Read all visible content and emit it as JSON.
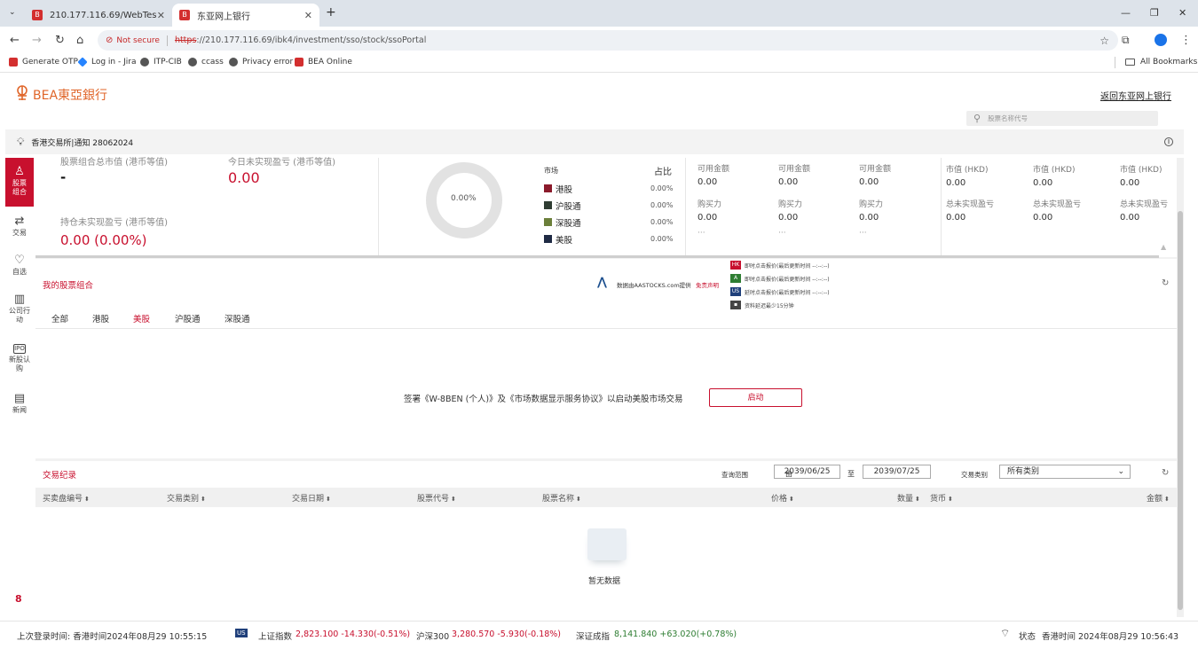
{
  "browser": {
    "tabs": [
      {
        "title": "210.177.116.69/WebTest/jsp/IB"
      },
      {
        "title": "东亚网上银行"
      }
    ],
    "new_tab": "+",
    "window_controls": [
      "—",
      "❐",
      "✕"
    ],
    "not_secure": "Not secure",
    "url_scheme": "https",
    "url_rest": "://210.177.116.69/ibk4/investment/sso/stock/ssoPortal",
    "bookmarks": [
      "Generate OTP",
      "Log in - Jira",
      "ITP-CIB",
      "ccass",
      "Privacy error",
      "BEA Online"
    ],
    "all_bookmarks": "All Bookmarks"
  },
  "header": {
    "logo_text": "BEA東亞銀行",
    "back_link": "返回东亚网上银行",
    "search_placeholder": "股票名称代号"
  },
  "notice": {
    "text": "香港交易所|通知 28062024"
  },
  "sidebar": {
    "items": [
      {
        "label": "股票组合",
        "icon": "person-icon"
      },
      {
        "label": "交易",
        "icon": "swap-icon"
      },
      {
        "label": "自选",
        "icon": "heart-icon"
      },
      {
        "label": "公司行动",
        "icon": "building-icon"
      },
      {
        "label": "新股认购",
        "icon": "ipo-icon"
      },
      {
        "label": "新闻",
        "icon": "news-icon"
      }
    ],
    "footer_logo": "8"
  },
  "summary": {
    "market_value_label": "股票组合总市值 (港币等值)",
    "market_value": "-",
    "today_pnl_label": "今日未实现盈亏 (港币等值)",
    "today_pnl": "0.00",
    "holding_pnl_label": "持仓未实现盈亏 (港币等值)",
    "holding_pnl": "0.00 (0.00%)",
    "donut_value": "0.00%",
    "market_header": "市场",
    "ratio_header": "占比",
    "markets": [
      {
        "name": "港股",
        "pct": "0.00%",
        "color": "#8b1a2b"
      },
      {
        "name": "沪股通",
        "pct": "0.00%",
        "color": "#2f3d33"
      },
      {
        "name": "深股通",
        "pct": "0.00%",
        "color": "#6b7f3a"
      },
      {
        "name": "美股",
        "pct": "0.00%",
        "color": "#1f2a44"
      }
    ],
    "cash_cols": [
      {
        "avail_label": "可用金额",
        "avail": "0.00",
        "power_label": "购买力",
        "power": "0.00",
        "more": "···"
      },
      {
        "avail_label": "可用金额",
        "avail": "0.00",
        "power_label": "购买力",
        "power": "0.00",
        "more": "···"
      },
      {
        "avail_label": "可用金额",
        "avail": "0.00",
        "power_label": "购买力",
        "power": "0.00",
        "more": "···"
      }
    ],
    "mv_cols": [
      {
        "mv_label": "市值 (HKD)",
        "mv": "0.00",
        "pnl_label": "总未实现盈亏",
        "pnl": "0.00"
      },
      {
        "mv_label": "市值 (HKD)",
        "mv": "0.00",
        "pnl_label": "总未实现盈亏",
        "pnl": "0.00"
      },
      {
        "mv_label": "市值 (HKD)",
        "mv": "0.00",
        "pnl_label": "总未实现盈亏",
        "pnl": "0.00"
      }
    ]
  },
  "portfolio": {
    "title": "我的股票组合",
    "data_source": "数据由AASTOCKS.com提供",
    "disclaimer": "免责声明",
    "legend": [
      {
        "badge": "HK",
        "text": "即时点击报价(最后更新时间 --:--:--)"
      },
      {
        "badge": "A",
        "text": "即时点击报价(最后更新时间 --:--:--)"
      },
      {
        "badge": "US",
        "text": "延时点击报价(最后更新时间 --:--:--)"
      },
      {
        "badge": "▪",
        "text": "资料延迟最少15分钟"
      }
    ],
    "tabs": [
      "全部",
      "港股",
      "美股",
      "沪股通",
      "深股通"
    ],
    "active_tab": "美股",
    "sign_text": "签署《W-8BEN (个人)》及《市场数据显示服务协议》以启动美股市场交易",
    "start_button": "启动"
  },
  "trades": {
    "title": "交易纪录",
    "range_label": "查询范围",
    "from_label": "由",
    "from_date": "2039/06/25",
    "to_label": "至",
    "to_date": "2039/07/25",
    "type_label": "交易类别",
    "type_value": "所有类别",
    "columns": [
      "买卖盘编号",
      "交易类别",
      "交易日期",
      "股票代号",
      "股票名称",
      "价格",
      "数量",
      "货币",
      "金额"
    ],
    "empty_text": "暂无数据"
  },
  "status": {
    "last_login": "上次登录时间: 香港时间2024年08月29 10:55:15",
    "market_badge": "US",
    "sh_label": "上证指数",
    "sh_value": "2,823.100 -14.330(-0.51%)",
    "hs300_label": "沪深300",
    "hs300_value": "3,280.570 -5.930(-0.18%)",
    "sz_label": "深证成指",
    "sz_value": "8,141.840 +63.020(+0.78%)",
    "state_label": "状态",
    "time": "香港时间 2024年08月29 10:56:43"
  },
  "colors": {
    "brand_red": "#c8102e",
    "logo_orange": "#e0662a",
    "up_green": "#2e7d32"
  }
}
